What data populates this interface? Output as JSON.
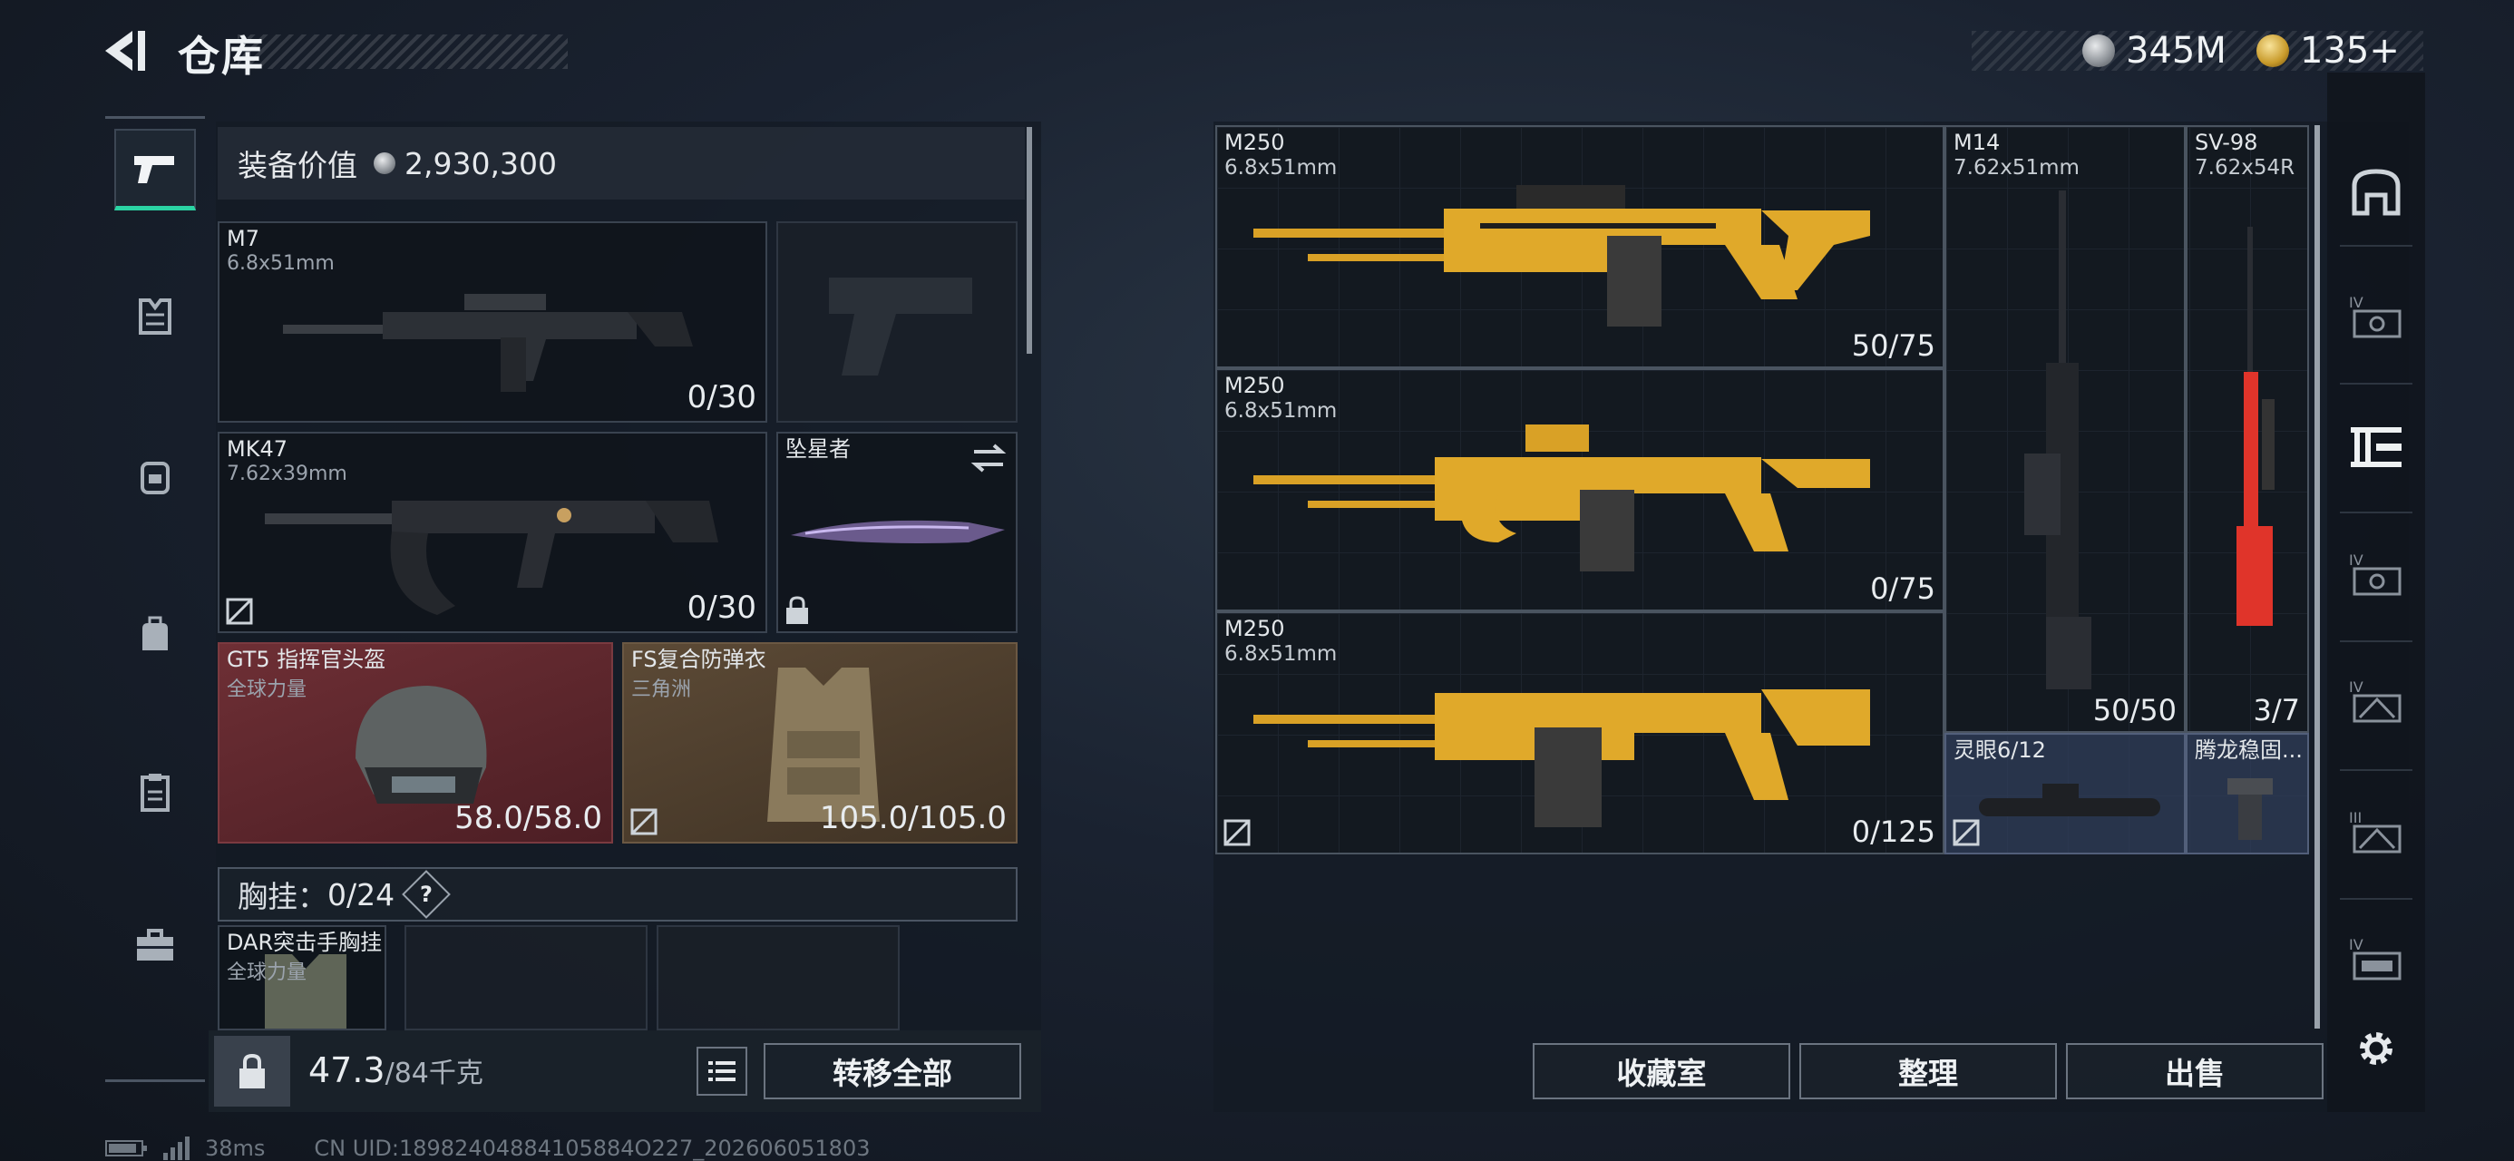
{
  "header": {
    "title": "仓库",
    "currency": [
      {
        "icon": "silver-coin-icon",
        "amount": "345M"
      },
      {
        "icon": "gold-coin-icon",
        "amount": "135+"
      }
    ]
  },
  "left_nav": [
    "pistol-icon",
    "armor-icon",
    "backpack-icon",
    "bag-icon",
    "clipboard-icon",
    "toolbox-icon"
  ],
  "loadout": {
    "value_label": "装备价值",
    "value": "2,930,300",
    "slots": [
      {
        "name": "M7",
        "caliber": "6.8x51mm",
        "count": "0/30"
      },
      {
        "name": "",
        "caliber": "",
        "count": ""
      },
      {
        "name": "MK47",
        "caliber": "7.62x39mm",
        "count": "0/30"
      },
      {
        "name": "坠星者",
        "caliber": "",
        "count": ""
      },
      {
        "name": "GT5 指挥官头盔",
        "caliber": "全球力量",
        "count": "58.0/58.0"
      },
      {
        "name": "FS复合防弹衣",
        "caliber": "三角洲",
        "count": "105.0/105.0"
      }
    ],
    "rig_label": "胸挂：",
    "rig_count": "0/24",
    "rig_help": "?",
    "rig_item": {
      "name": "DAR突击手胸挂",
      "sub": "全球力量"
    },
    "weight_current": "47.3",
    "weight_max": "/84千克",
    "transfer_all": "转移全部"
  },
  "storage": {
    "items": [
      {
        "name": "M250",
        "caliber": "6.8x51mm",
        "count": "50/75"
      },
      {
        "name": "M250",
        "caliber": "6.8x51mm",
        "count": "0/75"
      },
      {
        "name": "M250",
        "caliber": "6.8x51mm",
        "count": "0/125"
      },
      {
        "name": "M14",
        "caliber": "7.62x51mm",
        "count": "50/50"
      },
      {
        "name": "SV-98",
        "caliber": "7.62x54R",
        "count": "3/7"
      },
      {
        "name": "灵眼6/12",
        "caliber": "",
        "count": ""
      },
      {
        "name": "腾龙稳固...",
        "caliber": "",
        "count": ""
      }
    ],
    "buttons": {
      "collection": "收藏室",
      "sort": "整理",
      "sell": "出售"
    }
  },
  "right_nav": [
    "vault-icon",
    "storage-iv-icon",
    "weapon-rack-icon",
    "storage-iv-icon",
    "storage-iv-icon",
    "storage-iii-icon",
    "storage-iv-icon"
  ],
  "footer": {
    "ping": "38ms",
    "uid": "CN UID:18982404884105884O227_202606051803"
  },
  "colors": {
    "accent": "#2bd3a3",
    "weapon_gold": "#e0a92a",
    "helmet_red": "#6e2f35",
    "armor_brown": "#5c4a36"
  }
}
